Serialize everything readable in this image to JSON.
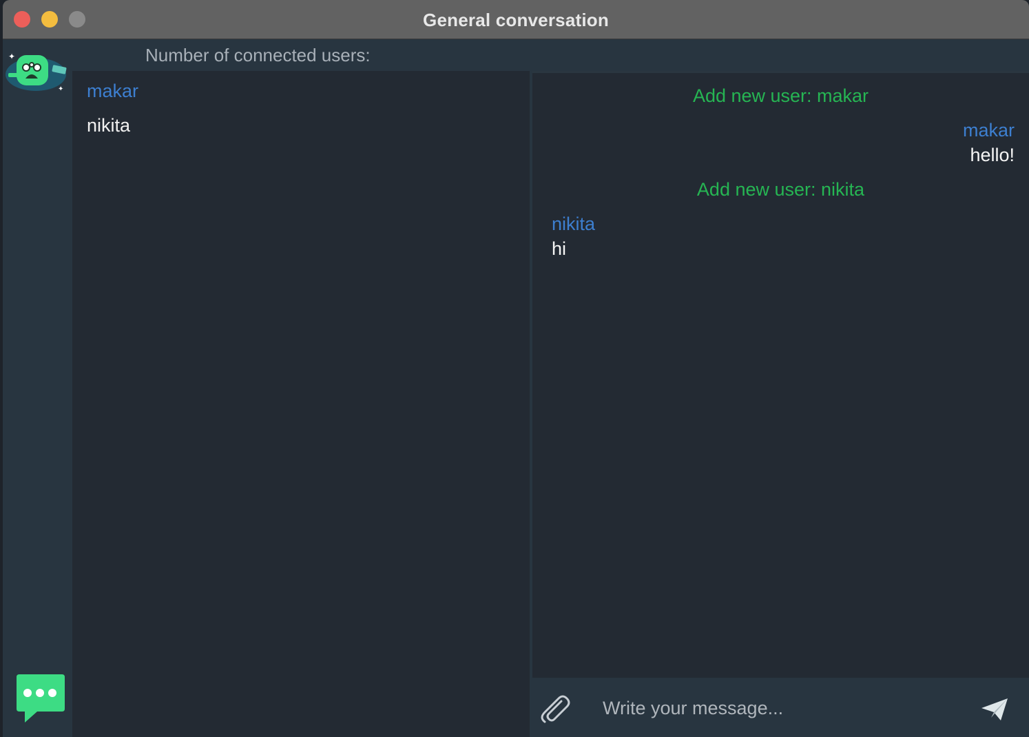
{
  "window": {
    "title": "General conversation"
  },
  "header": {
    "connected_users_label": "Number of connected users:"
  },
  "users": [
    {
      "name": "makar",
      "selected": true
    },
    {
      "name": "nikita",
      "selected": false
    }
  ],
  "chat": {
    "messages": [
      {
        "type": "system",
        "text": "Add new user: makar"
      },
      {
        "type": "outgoing",
        "author": "makar",
        "text": "hello!"
      },
      {
        "type": "system",
        "text": "Add new user: nikita"
      },
      {
        "type": "incoming",
        "author": "nikita",
        "text": "hi"
      }
    ]
  },
  "composer": {
    "placeholder": "Write your message..."
  },
  "colors": {
    "accent_blue": "#3d7fd0",
    "system_green": "#26b553",
    "brand_green": "#3ddc84"
  },
  "icons": {
    "logo": "app-logo-icon",
    "chat": "chat-bubble-icon",
    "attach": "paperclip-icon",
    "send": "send-plane-icon"
  }
}
